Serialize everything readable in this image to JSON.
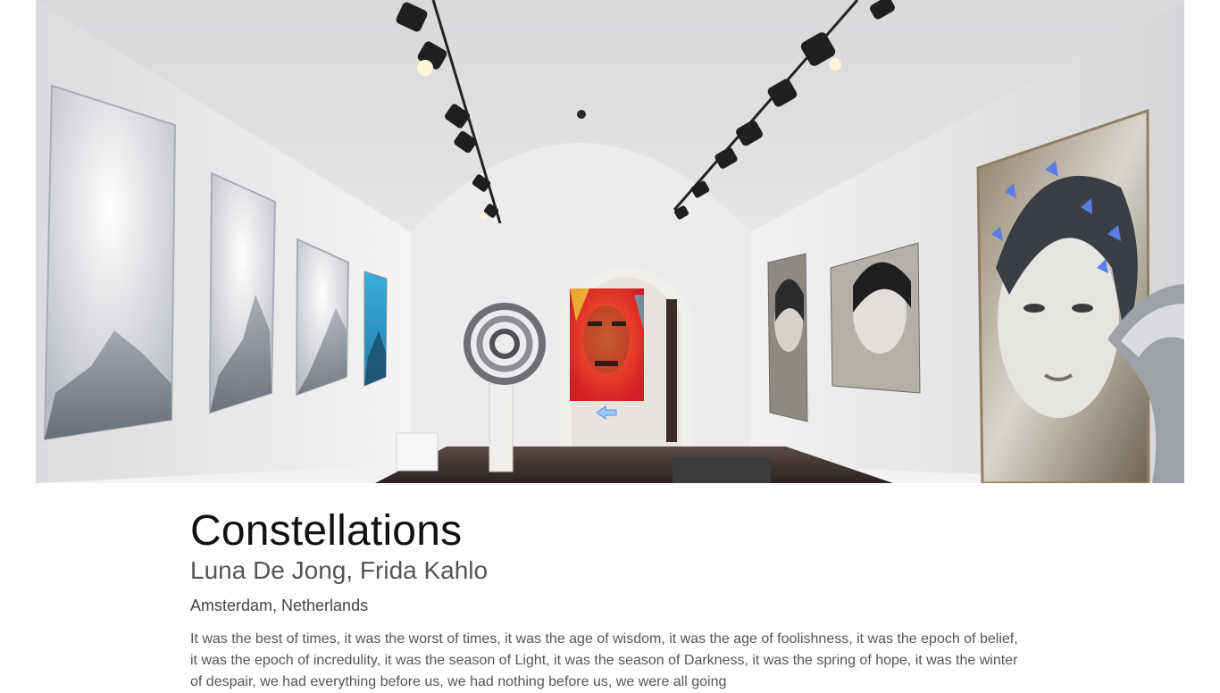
{
  "hero": {
    "image": "gallery-interior-photo"
  },
  "exhibition": {
    "title": "Constellations",
    "artists": "Luna De Jong, Frida Kahlo",
    "location": "Amsterdam, Netherlands",
    "description": "It was the best of times, it was the worst of times, it was the age of wisdom, it was the age of foolishness, it was the epoch of belief, it was the epoch of incredulity, it was the season of Light, it was the season of Darkness, it was the spring of hope, it was the winter of despair, we had everything before us, we had nothing before us, we were all going"
  },
  "colors": {
    "title": "#111111",
    "subtitle": "#555555",
    "body_text": "#555555"
  }
}
